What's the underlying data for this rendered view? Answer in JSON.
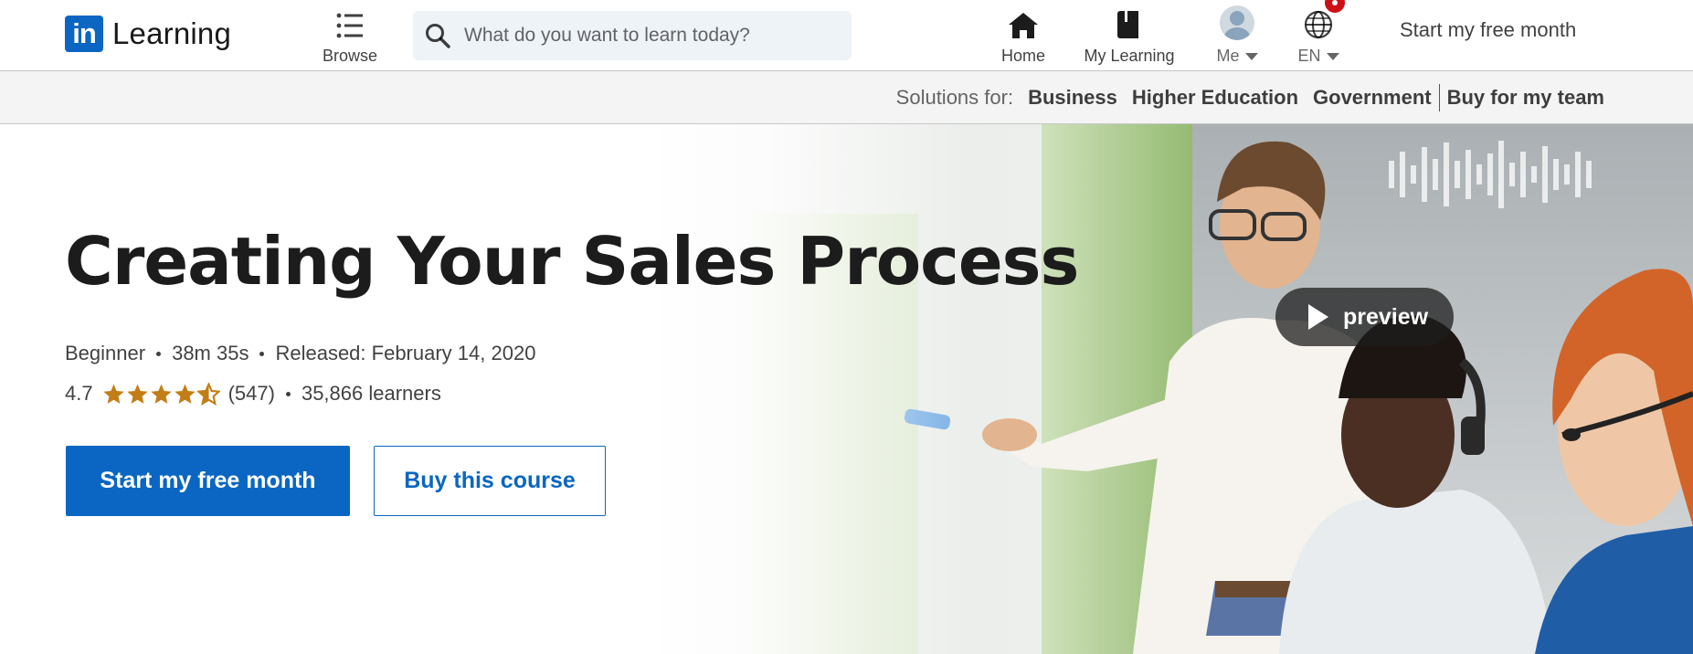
{
  "nav": {
    "logo_mark": "in",
    "logo_text": "Learning",
    "browse_label": "Browse",
    "search_placeholder": "What do you want to learn today?",
    "home_label": "Home",
    "my_learning_label": "My Learning",
    "me_label": "Me",
    "language_label": "EN",
    "cta_label": "Start my free month"
  },
  "solutions": {
    "label": "Solutions for:",
    "links": [
      "Business",
      "Higher Education",
      "Government",
      "Buy for my team"
    ]
  },
  "course": {
    "title": "Creating Your Sales Process",
    "level": "Beginner",
    "duration": "38m 35s",
    "released": "Released: February 14, 2020",
    "rating": "4.7",
    "rating_value": 4.7,
    "rating_count": "(547)",
    "learners": "35,866 learners",
    "primary_cta": "Start my free month",
    "secondary_cta": "Buy this course",
    "preview_label": "preview"
  },
  "colors": {
    "brand": "#0a66c2",
    "star": "#c37d16",
    "notification": "#cc1016"
  }
}
